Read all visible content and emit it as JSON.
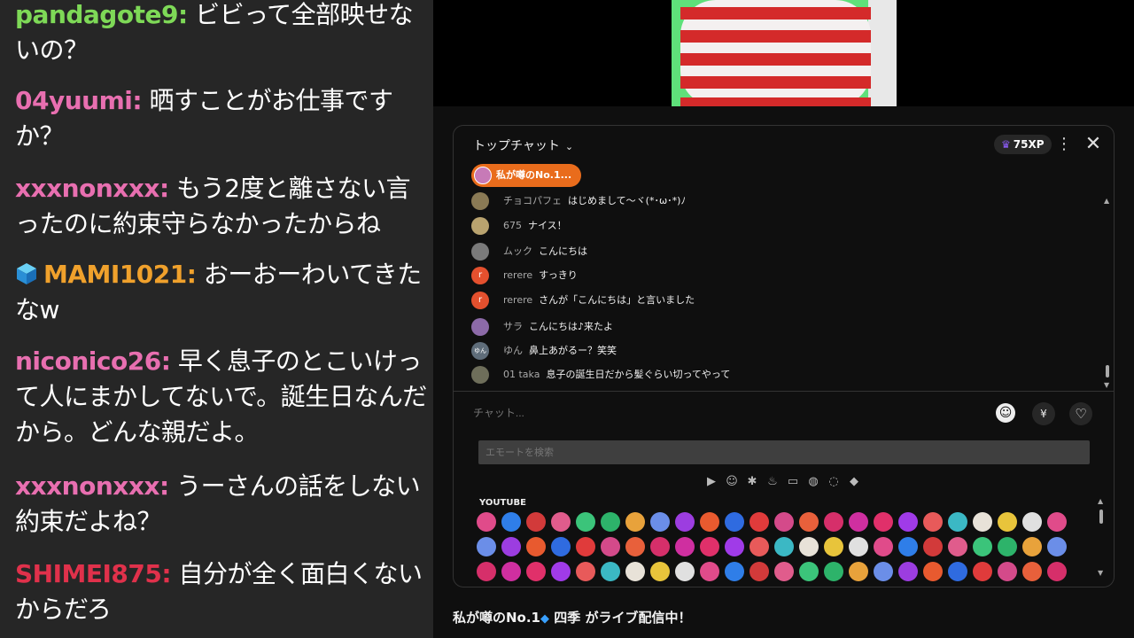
{
  "left_chat": {
    "messages": [
      {
        "user": "pandagote9:",
        "user_color": "#7ed957",
        "text": "ビビって全部映せないの？",
        "icon": ""
      },
      {
        "user": "04yuumi:",
        "user_color": "#e86fb0",
        "text": "晒すことがお仕事ですか？",
        "icon": ""
      },
      {
        "user": "xxxnonxxx:",
        "user_color": "#e86fb0",
        "text": "もう2度と離さない言ったのに約束守らなかったからね",
        "icon": ""
      },
      {
        "user": "MAMI1021:",
        "user_color": "#f0a12c",
        "text": "おーおーわいてきたなw",
        "icon": "cube-icon"
      },
      {
        "user": "niconico26:",
        "user_color": "#e86fb0",
        "text": "早く息子のとこいけって人にまかしてないで。誕生日なんだから。どんな親だよ。",
        "icon": ""
      },
      {
        "user": "xxxnonxxx:",
        "user_color": "#e86fb0",
        "text": "うーさんの話をしない約束だよね？",
        "icon": ""
      },
      {
        "user": "SHIMEI875:",
        "user_color": "#e0314b",
        "text": "自分が全く面白くないからだろ",
        "icon": ""
      }
    ]
  },
  "youtube": {
    "chat_mode": "トップチャット",
    "xp_badge": "75XP",
    "pinned_chip": "私が噂のNo.1...",
    "messages": [
      {
        "author": "チョコパフェ",
        "text": "はじめまして〜ヾ(*･ω･*)ﾉ",
        "avatar_color": "#8a7a55",
        "avatar_letter": ""
      },
      {
        "author": "675",
        "text": "ナイス！",
        "avatar_color": "#b9a36f",
        "avatar_letter": ""
      },
      {
        "author": "ムック",
        "text": "こんにちは",
        "avatar_color": "#7a7a7a",
        "avatar_letter": ""
      },
      {
        "author": "rerere",
        "text": "すっきり",
        "avatar_color": "#e4502e",
        "avatar_letter": "r"
      },
      {
        "author": "rerere",
        "text": "さんが「こんにちは」と言いました",
        "avatar_color": "#e4502e",
        "avatar_letter": "r"
      },
      {
        "author": "サラ",
        "text": "こんにちは♪来たよ",
        "avatar_color": "#8c6aa8",
        "avatar_letter": ""
      },
      {
        "author": "ゆん",
        "text": "鼻上あがるー？笑笑",
        "avatar_color": "#5f6d7a",
        "avatar_letter": "ゆん"
      },
      {
        "author": "01 taka",
        "text": "息子の誕生日だから髪ぐらい切ってやって",
        "avatar_color": "#6e6e5a",
        "avatar_letter": ""
      }
    ],
    "chat_input_placeholder": "チャット...",
    "emote_search_placeholder": "エモートを検索",
    "emote_section_label": "YOUTUBE",
    "emote_category_icons": [
      "play-icon",
      "smiley-icon",
      "gear-icon",
      "cake-icon",
      "car-icon",
      "ball-icon",
      "bulb-icon",
      "diamond-icon"
    ],
    "emote_colors": [
      "#e04b8a",
      "#2f7ee8",
      "#d23a3a",
      "#e05c8c",
      "#3bc47a",
      "#2db36a",
      "#e8a23b",
      "#6b8ee8",
      "#9c3de0",
      "#e85a2f",
      "#2f6be0",
      "#e03b3b",
      "#d44a8a",
      "#e8603b",
      "#d62f6a",
      "#cf2fa0",
      "#e0306a",
      "#a03be8",
      "#e85a5a",
      "#3bb8c4",
      "#e8e2d8",
      "#e8c43b",
      "#e0e0e0"
    ],
    "live_caption_prefix": "私が噂のNo.1",
    "live_caption_suffix": "四季 がライブ配信中！"
  }
}
